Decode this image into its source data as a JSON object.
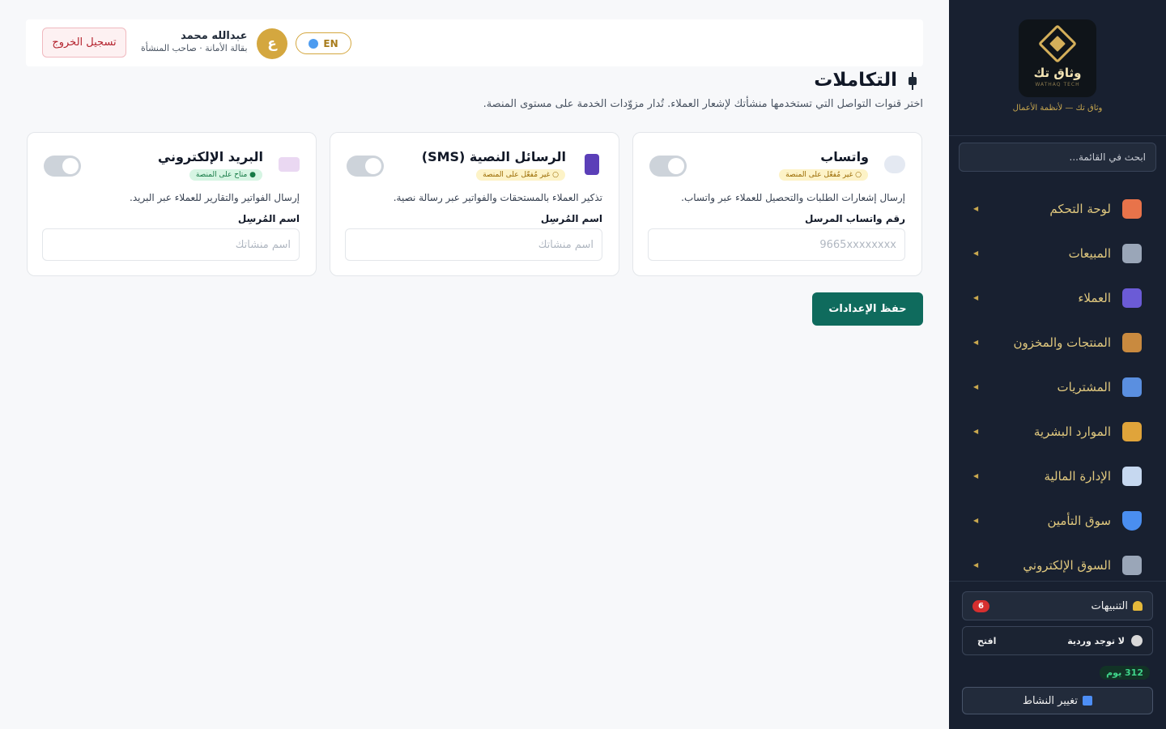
{
  "sidebar": {
    "logo_text": "وثاق تك",
    "logo_sub": "WATHAQ TECH",
    "tagline": "وثاق تك — لأنظمة الأعمال",
    "search_placeholder": "ابحث في القائمة...",
    "items": [
      {
        "label": "لوحة التحكم",
        "icon": "home-icon",
        "color": "#e8734a"
      },
      {
        "label": "المبيعات",
        "icon": "cart-icon",
        "color": "#9aa6b8"
      },
      {
        "label": "العملاء",
        "icon": "users-icon",
        "color": "#6b5bd6"
      },
      {
        "label": "المنتجات والمخزون",
        "icon": "box-icon",
        "color": "#c98a3f"
      },
      {
        "label": "المشتريات",
        "icon": "inbox-icon",
        "color": "#5a8fe0"
      },
      {
        "label": "الموارد البشرية",
        "icon": "worker-icon",
        "color": "#e0a43a"
      },
      {
        "label": "الإدارة المالية",
        "icon": "chart-icon",
        "color": "#c6d8f0"
      },
      {
        "label": "سوق التأمين",
        "icon": "shield-icon",
        "color": "#4a8ef0"
      },
      {
        "label": "السوق الإلكتروني",
        "icon": "cart-icon",
        "color": "#9aa6b8"
      }
    ],
    "notifications": {
      "label": "التنبيهات",
      "count": "6"
    },
    "shift": {
      "label": "لا توجد وردية",
      "open_label": "افتح"
    },
    "days_left": "312 يوم",
    "change_activity": "تغيير النشاط"
  },
  "topbar": {
    "logout": "تسجيل الخروج",
    "user_name": "عبدالله محمد",
    "user_sub": "بقالة الأمانة · صاحب المنشأة",
    "avatar_letter": "ع",
    "lang": "EN"
  },
  "page": {
    "title": "التكاملات",
    "description": "اختر قنوات التواصل التي تستخدمها منشأتك لإشعار العملاء. تُدار مزوّدات الخدمة على مستوى المنصة."
  },
  "cards": [
    {
      "title": "واتساب",
      "icon": "chat-bubble-icon",
      "badge": "○ غير مُفعّل على المنصة",
      "badge_state": "warning",
      "description": "إرسال إشعارات الطلبات والتحصيل للعملاء عبر واتساب.",
      "field_label": "رقم واتساب المرسل",
      "field_placeholder": "9665xxxxxxxx"
    },
    {
      "title": "الرسائل النصية (SMS)",
      "icon": "phone-icon",
      "badge": "○ غير مُفعّل على المنصة",
      "badge_state": "warning",
      "description": "تذكير العملاء بالمستحقات والفواتير عبر رسالة نصية.",
      "field_label": "اسم المُرسِل",
      "field_placeholder": "اسم منشأتك"
    },
    {
      "title": "البريد الإلكتروني",
      "icon": "envelope-icon",
      "badge": "● متاح على المنصة",
      "badge_state": "ok",
      "description": "إرسال الفواتير والتقارير للعملاء عبر البريد.",
      "field_label": "اسم المُرسِل",
      "field_placeholder": "اسم منشأتك"
    }
  ],
  "save_label": "حفظ الإعدادات"
}
